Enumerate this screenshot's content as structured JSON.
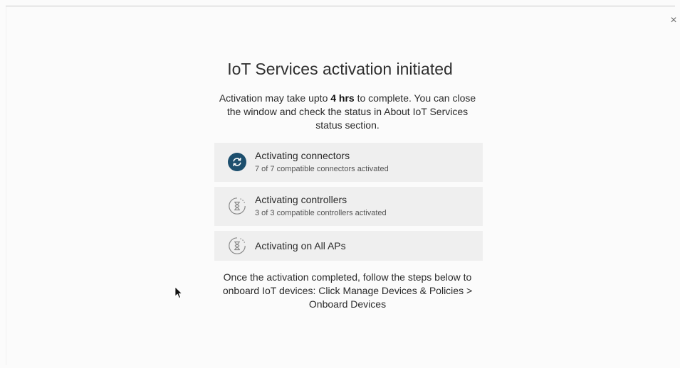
{
  "dialog": {
    "close_label": "×",
    "title": "IoT Services activation initiated",
    "description_before": "Activation may take upto ",
    "description_bold": "4 hrs",
    "description_after": " to complete. You can close the window and check the status in About IoT Services status section.",
    "steps": [
      {
        "title": "Activating connectors",
        "subtitle": "7 of 7 compatible connectors activated",
        "icon": "refresh-icon",
        "status": "in-progress"
      },
      {
        "title": "Activating controllers",
        "subtitle": "3 of 3 compatible controllers activated",
        "icon": "hourglass-icon",
        "status": "pending"
      },
      {
        "title": "Activating on All APs",
        "icon": "hourglass-icon",
        "status": "pending"
      }
    ],
    "footer": "Once the activation completed, follow the steps below to onboard IoT devices: Click Manage Devices & Policies > Onboard Devices"
  },
  "colors": {
    "active_icon": "#1d4f6e",
    "pending_icon": "#8a8a8a",
    "step_background": "#efefef"
  }
}
